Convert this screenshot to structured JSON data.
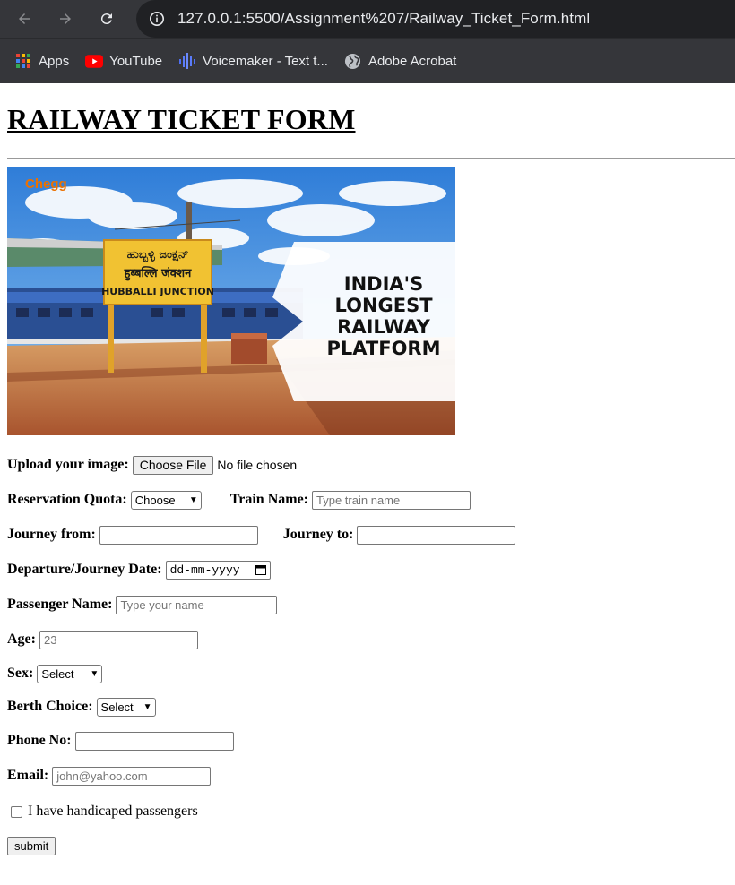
{
  "browser": {
    "url": "127.0.0.1:5500/Assignment%207/Railway_Ticket_Form.html",
    "bookmarks": [
      {
        "label": "Apps",
        "icon": "apps-grid-icon"
      },
      {
        "label": "YouTube",
        "icon": "youtube-icon"
      },
      {
        "label": "Voicemaker - Text t...",
        "icon": "voicemaker-icon"
      },
      {
        "label": "Adobe Acrobat",
        "icon": "globe-icon"
      }
    ]
  },
  "page": {
    "title": "RAILWAY TICKET FORM",
    "hero": {
      "brand": "Chegg",
      "sign_kannada": "ಹುಬ್ಬಳ್ಳಿ ಜಂಕ್ಷನ್",
      "sign_hindi": "हुब्बल्लि जंक्शन",
      "sign_english": "HUBBALLI JUNCTION",
      "headline_lines": [
        "INDIA'S",
        "LONGEST",
        "RAILWAY",
        "PLATFORM"
      ]
    },
    "form": {
      "upload_label": "Upload your image:",
      "upload_button": "Choose File",
      "upload_status": "No file chosen",
      "quota_label": "Reservation Quota:",
      "quota_value": "Choose",
      "train_label": "Train Name:",
      "train_placeholder": "Type train name",
      "from_label": "Journey from:",
      "to_label": "Journey to:",
      "date_label": "Departure/Journey Date:",
      "date_placeholder": "dd-mm-yyyy",
      "name_label": "Passenger Name:",
      "name_placeholder": "Type your name",
      "age_label": "Age:",
      "age_placeholder": "23",
      "sex_label": "Sex:",
      "sex_value": "Select",
      "berth_label": "Berth Choice:",
      "berth_value": "Select",
      "phone_label": "Phone No:",
      "email_label": "Email:",
      "email_placeholder": "john@yahoo.com",
      "handicap_label": "I have handicaped passengers",
      "submit_label": "submit"
    }
  }
}
